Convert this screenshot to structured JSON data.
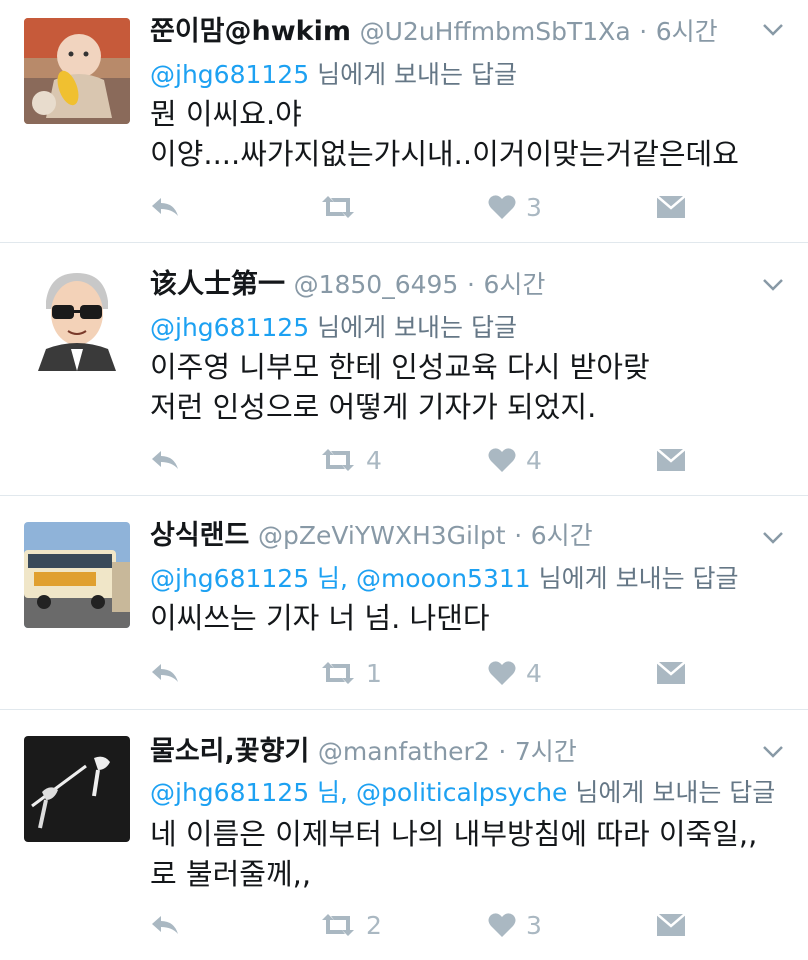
{
  "tweets": [
    {
      "name": "쭌이맘@hwkim",
      "handle": "@U2uHffmbmSbT1Xa",
      "dot": "·",
      "time": "6시간",
      "reply_to": [
        "@jhg681125"
      ],
      "reply_suffix": "님에게 보내는 답글",
      "body": [
        "뭔 이씨요.야",
        "이양....싸가지없는가시내..이거이맞는거같은데요"
      ],
      "retweets": "",
      "likes": "3"
    },
    {
      "name": "该人士第一",
      "handle": "@1850_6495",
      "dot": "·",
      "time": "6시간",
      "reply_to": [
        "@jhg681125"
      ],
      "reply_suffix": "님에게 보내는 답글",
      "body": [
        "이주영 니부모 한테 인성교육 다시 받아랒",
        "저런 인성으로 어떻게 기자가 되었지."
      ],
      "retweets": "4",
      "likes": "4"
    },
    {
      "name": "상식랜드",
      "handle": "@pZeViYWXH3Gilpt",
      "dot": "·",
      "time": "6시간",
      "reply_to": [
        "@jhg681125 님,",
        "@mooon5311"
      ],
      "reply_suffix": "님에게 보내는 답글",
      "body": [
        "이씨쓰는 기자 너 넘. 나댄다"
      ],
      "retweets": "1",
      "likes": "4"
    },
    {
      "name": "물소리,꽃향기",
      "handle": "@manfather2",
      "dot": "·",
      "time": "7시간",
      "reply_to": [
        "@jhg681125 님,",
        "@politicalpsyche"
      ],
      "reply_suffix": "님에게 보내는 답글",
      "body": [
        "네 이름은 이제부터 나의 내부방침에 따라 이죽일,,",
        "로 불러줄께,,"
      ],
      "retweets": "2",
      "likes": "3"
    }
  ],
  "colors": {
    "link": "#1da1f2",
    "muted": "#8899a6",
    "icon": "#aab8c2",
    "divider": "#e1e8ed"
  }
}
